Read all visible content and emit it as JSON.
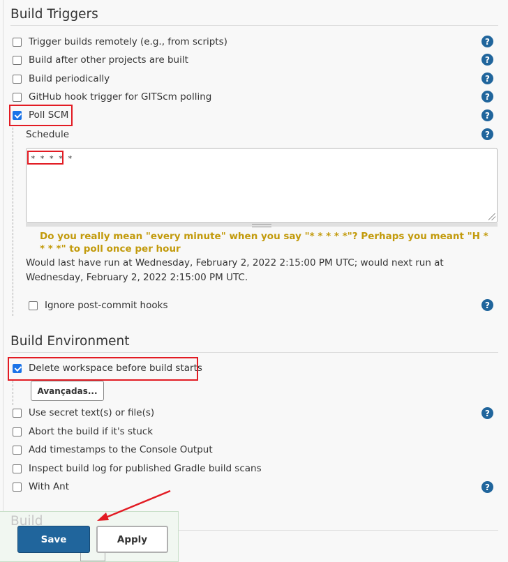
{
  "build_triggers": {
    "title": "Build Triggers",
    "options": [
      {
        "label": "Trigger builds remotely (e.g., from scripts)",
        "checked": false
      },
      {
        "label": "Build after other projects are built",
        "checked": false
      },
      {
        "label": "Build periodically",
        "checked": false
      },
      {
        "label": "GitHub hook trigger for GITScm polling",
        "checked": false
      },
      {
        "label": "Poll SCM",
        "checked": true
      }
    ],
    "schedule_label": "Schedule",
    "schedule_value": "* * * * *",
    "warning": "Do you really mean \"every minute\" when you say \"* * * * *\"? Perhaps you meant \"H * * * *\" to poll once per hour",
    "run_info": "Would last have run at Wednesday, February 2, 2022 2:15:00 PM UTC; would next run at Wednesday, February 2, 2022 2:15:00 PM UTC.",
    "ignore_hooks_label": "Ignore post-commit hooks",
    "ignore_hooks_checked": false
  },
  "build_environment": {
    "title": "Build Environment",
    "delete_workspace_label": "Delete workspace before build starts",
    "delete_workspace_checked": true,
    "advanced_label": "Avançadas...",
    "options": [
      {
        "label": "Use secret text(s) or file(s)",
        "checked": false
      },
      {
        "label": "Abort the build if it's stuck",
        "checked": false
      },
      {
        "label": "Add timestamps to the Console Output",
        "checked": false
      },
      {
        "label": "Inspect build log for published Gradle build scans",
        "checked": false
      },
      {
        "label": "With Ant",
        "checked": false
      }
    ]
  },
  "build_section": {
    "title": "Build"
  },
  "actions": {
    "save_label": "Save",
    "apply_label": "Apply"
  },
  "help_glyph": "?",
  "colors": {
    "accent": "#20659c",
    "highlight": "#e21b23",
    "warning": "#c29a0b",
    "checkbox_checked": "#1a73e8"
  }
}
